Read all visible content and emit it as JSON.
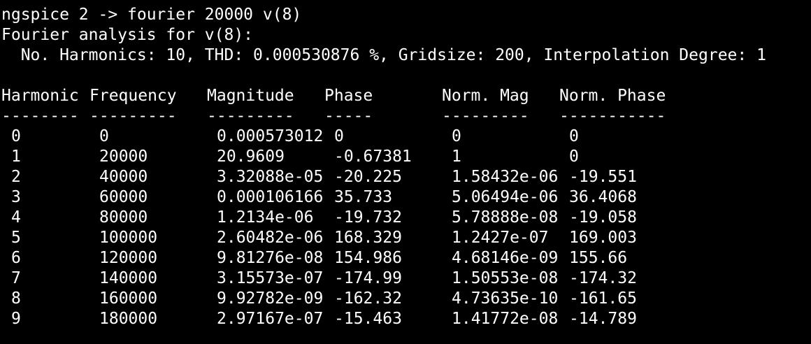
{
  "terminal": {
    "command_line": "ngspice 2 -> fourier 20000 v(8)",
    "analysis_title": "Fourier analysis for v(8):",
    "summary": "  No. Harmonics: 10, THD: 0.000530876 %, Gridsize: 200, Interpolation Degree: 1",
    "table": {
      "headers": [
        "Harmonic",
        "Frequency",
        "Magnitude",
        "Phase",
        "Norm. Mag",
        "Norm. Phase"
      ],
      "separators": [
        "--------",
        "---------",
        "---------",
        "-----",
        "---------",
        "-----------"
      ],
      "rows": [
        [
          "0",
          "0",
          "0.000573012",
          "0",
          "0",
          "0"
        ],
        [
          "1",
          "20000",
          "20.9609",
          "-0.67381",
          "1",
          "0"
        ],
        [
          "2",
          "40000",
          "3.32088e-05",
          "-20.225",
          "1.58432e-06",
          "-19.551"
        ],
        [
          "3",
          "60000",
          "0.000106166",
          "35.733",
          "5.06494e-06",
          "36.4068"
        ],
        [
          "4",
          "80000",
          "1.2134e-06",
          "-19.732",
          "5.78888e-08",
          "-19.058"
        ],
        [
          "5",
          "100000",
          "2.60482e-06",
          "168.329",
          "1.2427e-07",
          "169.003"
        ],
        [
          "6",
          "120000",
          "9.81276e-08",
          "154.986",
          "4.68146e-09",
          "155.66"
        ],
        [
          "7",
          "140000",
          "3.15573e-07",
          "-174.99",
          "1.50553e-08",
          "-174.32"
        ],
        [
          "8",
          "160000",
          "9.92782e-09",
          "-162.32",
          "4.73635e-10",
          "-161.65"
        ],
        [
          "9",
          "180000",
          "2.97167e-07",
          "-15.463",
          "1.41772e-08",
          "-14.789"
        ]
      ]
    }
  }
}
